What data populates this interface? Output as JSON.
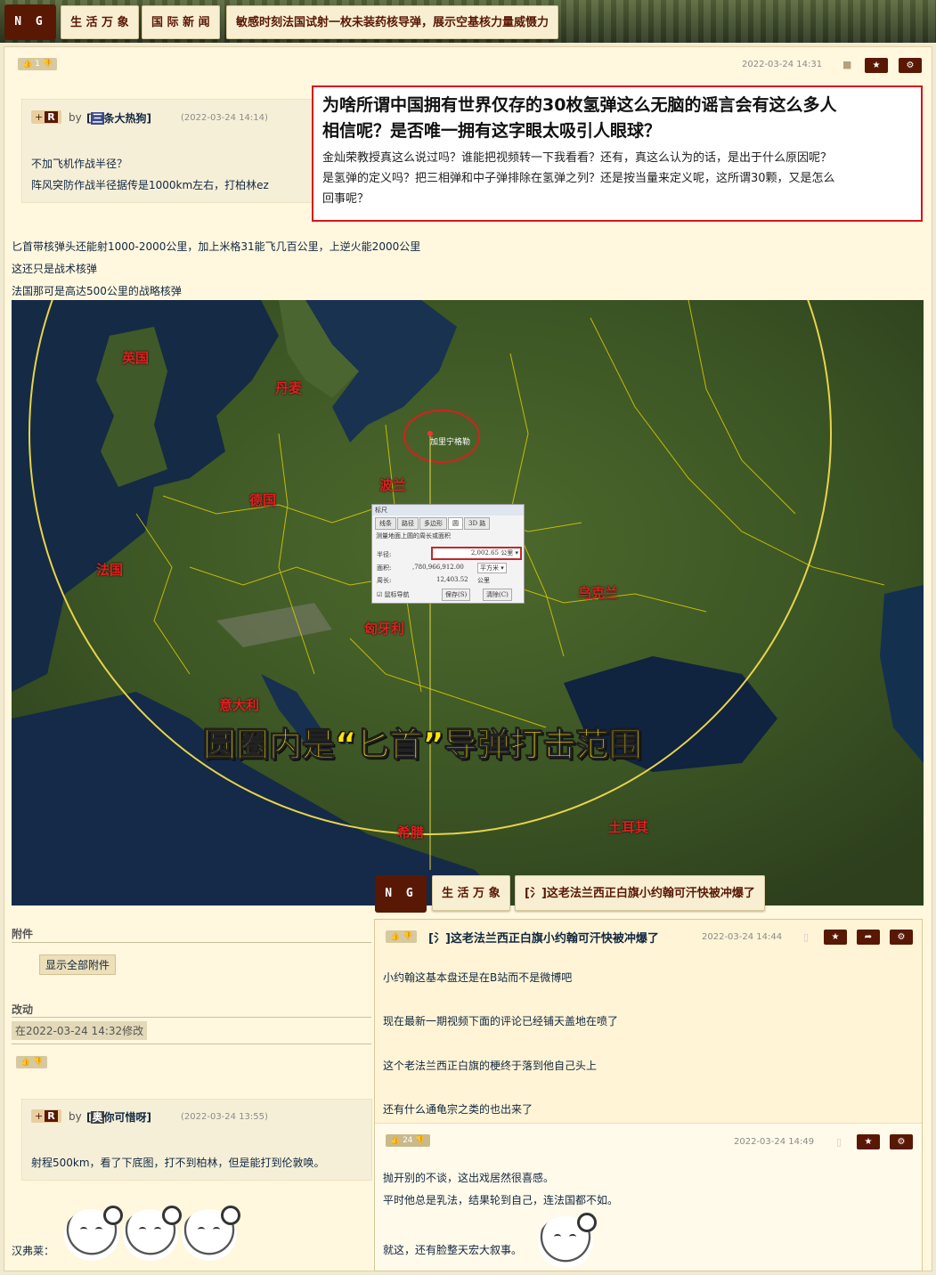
{
  "top_nav": {
    "logo": "N G A",
    "crumb1": "生 活 万 象",
    "crumb2": "国 际 新 闻",
    "title": "敏感时刻法国试射一枚未装药核导弹，展示空基核力量威慑力"
  },
  "main_post": {
    "like_count": "1",
    "timestamp": "2022-03-24 14:31",
    "quote": {
      "by": "by",
      "user": "[三条大热狗]",
      "user_prefix": "三",
      "user_name": "条大热狗]",
      "timestamp": "(2022-03-24 14:14)",
      "line1": "不加飞机作战半径？",
      "line2": "阵风突防作战半径据传是1000km左右，打柏林ez"
    },
    "red_box": {
      "headline1": "为啥所谓中国拥有世界仅存的30枚氢弹这么无脑的谣言会有这么多人",
      "headline2": "相信呢？是否唯一拥有这字眼太吸引人眼球？",
      "body1": "金灿荣教授真这么说过吗？谁能把视频转一下我看看？还有，真这么认为的话，是出于什么原因呢？",
      "body2": "是氢弹的定义吗？把三相弹和中子弹排除在氢弹之列？还是按当量来定义呢，这所谓30颗，又是怎么",
      "body3": "回事呢？"
    },
    "body1": "匕首带核弹头还能射1000-2000公里，加上米格31能飞几百公里，上逆火能2000公里",
    "body2": "这还只是战术核弹",
    "body3": "法国那可是高达500公里的战略核弹",
    "map": {
      "caption": "圆圈内是“匕首”导弹打击范围",
      "countries": [
        "英国",
        "丹麦",
        "德国",
        "波兰",
        "法国",
        "匈牙利",
        "乌克兰",
        "意大利",
        "希腊",
        "土耳其"
      ],
      "target_label": "加里宁格勒",
      "ruler": {
        "title": "标尺",
        "tabs": [
          "线条",
          "路径",
          "多边形",
          "圆",
          "3D 路"
        ],
        "desc": "测量地面上圆的周长或面积",
        "radius_label": "半径:",
        "radius_value": "2,002.65",
        "radius_unit": "公里",
        "area_label": "面积:",
        "area_value": ",780,966,912.00",
        "area_unit": "平方米",
        "perim_label": "周长:",
        "perim_value": "12,403.52",
        "perim_unit": "公里",
        "nav_label": "鼠标导航",
        "save": "保存(S)",
        "clear": "清除(C)"
      }
    },
    "attachments_label": "附件",
    "show_all": "显示全部附件",
    "changes_label": "改动",
    "modified": "在2022-03-24 14:32修改"
  },
  "second_post": {
    "quote": {
      "by": "by",
      "user_prefix": "奥",
      "user_name": "你可惜呀]",
      "timestamp": "(2022-03-24 13:55)",
      "line1": "射程500km，看了下底图，打不到柏林，但是能打到伦敦唤。"
    },
    "sig": "汉弗莱："
  },
  "overlay": {
    "logo": "N G A",
    "crumb1": "生 活 万 象",
    "crumb2": "[氵]这老法兰西正白旗小约翰可汗快被冲爆了",
    "title": "[氵]这老法兰西正白旗小约翰可汗快被冲爆了",
    "timestamp": "2022-03-24 14:44",
    "line1": "小约翰这基本盘还是在B站而不是微博吧",
    "line2": "现在最新一期视频下面的评论已经铺天盖地在喷了",
    "line3": "这个老法兰西正白旗的梗终于落到他自己头上",
    "line4": "还有什么通龟宗之类的也出来了",
    "reply": {
      "likes": "24",
      "timestamp": "2022-03-24 14:49",
      "line1": "抛开别的不谈，这出戏居然很喜感。",
      "line2": "平时他总是乳法，结果轮到自己，连法国都不如。",
      "line3": "就这，还有脸整天宏大叙事。"
    }
  },
  "colors": {
    "accent": "#591804",
    "background": "#fff7de",
    "red_box_border": "#d9141b",
    "caption": "#ffe600"
  }
}
